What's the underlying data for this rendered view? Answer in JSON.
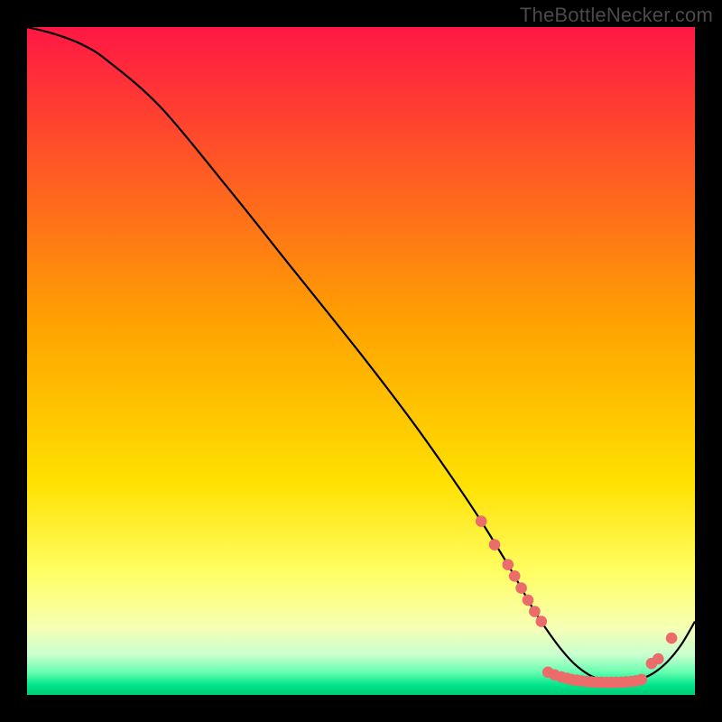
{
  "watermark": "TheBottleNecker.com",
  "chart_data": {
    "type": "line",
    "title": "",
    "xlabel": "",
    "ylabel": "",
    "xlim": [
      0,
      100
    ],
    "ylim": [
      0,
      100
    ],
    "grid": false,
    "legend": false,
    "gradient_stops": [
      {
        "pct": 0.0,
        "color": "#ff1744"
      },
      {
        "pct": 0.45,
        "color": "#ffa400"
      },
      {
        "pct": 0.68,
        "color": "#ffe000"
      },
      {
        "pct": 0.82,
        "color": "#ffff66"
      },
      {
        "pct": 0.9,
        "color": "#f6ffb5"
      },
      {
        "pct": 0.94,
        "color": "#c9ffcf"
      },
      {
        "pct": 0.965,
        "color": "#6bffb1"
      },
      {
        "pct": 0.985,
        "color": "#00e58a"
      },
      {
        "pct": 1.0,
        "color": "#00cc74"
      }
    ],
    "series": [
      {
        "name": "curve",
        "x": [
          0,
          4,
          8,
          12,
          20,
          30,
          40,
          50,
          58,
          64,
          68,
          72,
          74,
          76,
          78,
          80,
          82,
          84,
          86,
          88,
          90,
          92,
          94,
          96,
          98,
          100
        ],
        "y": [
          100,
          99,
          97.5,
          95,
          88,
          76,
          63.5,
          51,
          40.5,
          32,
          26,
          19.5,
          16,
          12.5,
          9.5,
          6.8,
          4.6,
          3.1,
          2.2,
          1.8,
          1.9,
          2.4,
          3.4,
          5.1,
          7.6,
          11
        ]
      }
    ],
    "markers": [
      {
        "x": 68,
        "y": 26.0
      },
      {
        "x": 70,
        "y": 22.5
      },
      {
        "x": 72,
        "y": 19.5
      },
      {
        "x": 73,
        "y": 17.8
      },
      {
        "x": 74,
        "y": 16.0
      },
      {
        "x": 75,
        "y": 14.2
      },
      {
        "x": 76,
        "y": 12.5
      },
      {
        "x": 77,
        "y": 11.0
      },
      {
        "x": 78,
        "y": 3.4
      },
      {
        "x": 79,
        "y": 3.0
      },
      {
        "x": 80,
        "y": 2.7
      },
      {
        "x": 80.8,
        "y": 2.5
      },
      {
        "x": 81.5,
        "y": 2.3
      },
      {
        "x": 82.3,
        "y": 2.2
      },
      {
        "x": 83,
        "y": 2.1
      },
      {
        "x": 83.8,
        "y": 2.0
      },
      {
        "x": 84.5,
        "y": 1.95
      },
      {
        "x": 85.3,
        "y": 1.9
      },
      {
        "x": 86,
        "y": 1.88
      },
      {
        "x": 86.8,
        "y": 1.87
      },
      {
        "x": 87.5,
        "y": 1.87
      },
      {
        "x": 88.2,
        "y": 1.88
      },
      {
        "x": 89,
        "y": 1.9
      },
      {
        "x": 89.7,
        "y": 1.95
      },
      {
        "x": 90.5,
        "y": 2.0
      },
      {
        "x": 91.2,
        "y": 2.1
      },
      {
        "x": 92,
        "y": 2.3
      },
      {
        "x": 93.5,
        "y": 4.7
      },
      {
        "x": 94.5,
        "y": 5.4
      },
      {
        "x": 96.5,
        "y": 8.5
      }
    ],
    "marker_color": "#ec6b6b",
    "curve_color": "#000000"
  }
}
